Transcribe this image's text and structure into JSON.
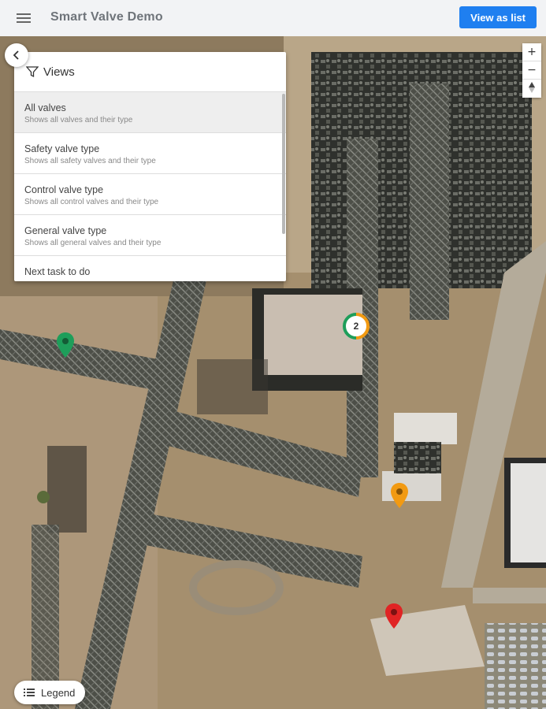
{
  "app": {
    "title": "Smart Valve Demo",
    "view_as_list_label": "View as list"
  },
  "views_panel": {
    "title": "Views",
    "items": [
      {
        "name": "All valves",
        "description": "Shows all valves and their type",
        "active": true
      },
      {
        "name": "Safety valve type",
        "description": "Shows all safety valves and their type",
        "active": false
      },
      {
        "name": "Control valve type",
        "description": "Shows all control valves and their type",
        "active": false
      },
      {
        "name": "General valve type",
        "description": "Shows all general valves and their type",
        "active": false
      },
      {
        "name": "Next task to do",
        "description": "",
        "active": false
      }
    ]
  },
  "zoom": {
    "in": "+",
    "out": "−",
    "reset": "compass"
  },
  "legend": {
    "label": "Legend"
  },
  "markers": {
    "cluster_count": "2",
    "colors": {
      "green": "#1e9e5a",
      "orange": "#f29a12",
      "red": "#e02424"
    }
  },
  "colors": {
    "accent": "#1f7ff0"
  }
}
